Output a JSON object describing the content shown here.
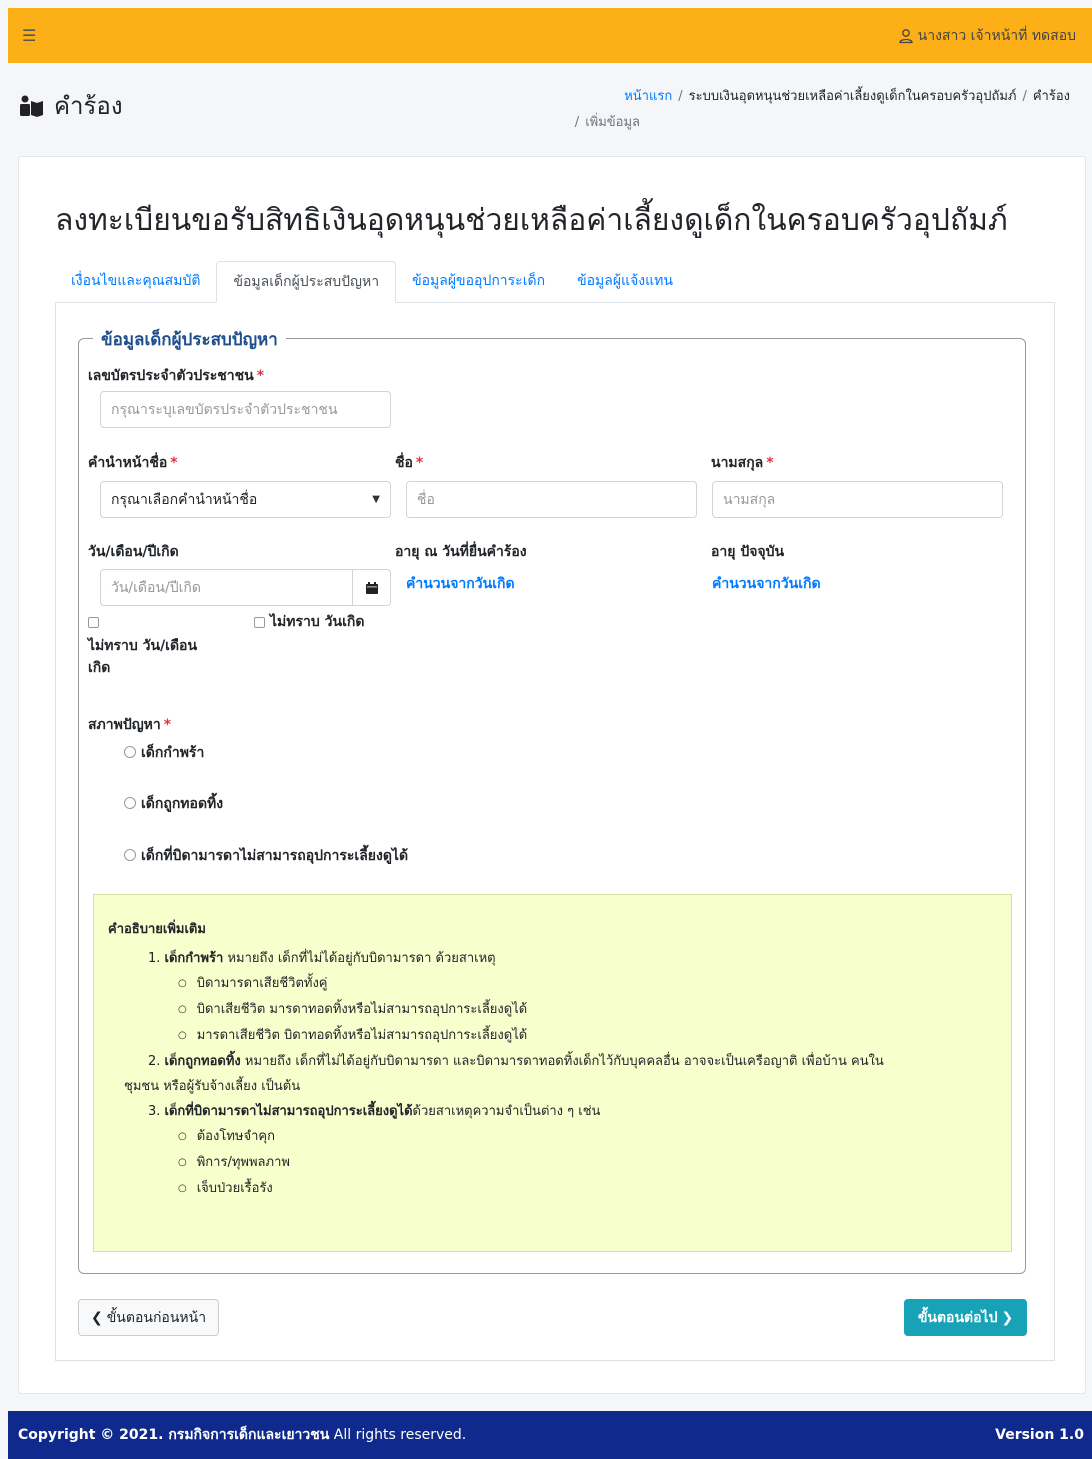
{
  "topbar": {
    "menu_icon": "hamburger-icon",
    "user_icon": "user-icon",
    "user_name": "นางสาว เจ้าหน้าที่ ทดสอบ"
  },
  "header": {
    "page_icon": "user-info-icon",
    "page_title": "คำร้อง",
    "breadcrumb": [
      "หน้าแรก",
      "ระบบเงินอุดหนุนช่วยเหลือค่าเลี้ยงดูเด็กในครอบครัวอุปถัมภ์",
      "คำร้อง",
      "เพิ่มข้อมูล"
    ]
  },
  "form": {
    "title": "ลงทะเบียนขอรับสิทธิเงินอุดหนุนช่วยเหลือค่าเลี้ยงดูเด็กในครอบครัวอุปถัมภ์",
    "tabs": [
      {
        "label": "เงื่อนไขและคุณสมบัติ",
        "active": false
      },
      {
        "label": "ข้อมูลเด็กผู้ประสบปัญหา",
        "active": true
      },
      {
        "label": "ข้อมูลผู้ขออุปการะเด็ก",
        "active": false
      },
      {
        "label": "ข้อมูลผู้แจ้งแทน",
        "active": false
      }
    ],
    "section_title": "ข้อมูลเด็กผู้ประสบปัญหา",
    "id_card": {
      "label": "เลขบัตรประจำตัวประชาชน",
      "placeholder": "กรุณาระบุเลขบัตรประจำตัวประชาชน",
      "value": ""
    },
    "prefix": {
      "label": "คำนำหน้าชื่อ",
      "selected": "กรุณาเลือกคำนำหน้าชื่อ"
    },
    "first_name": {
      "label": "ชื่อ",
      "placeholder": "ชื่อ",
      "value": ""
    },
    "last_name": {
      "label": "นามสกุล",
      "placeholder": "นามสกุล",
      "value": ""
    },
    "birth_date": {
      "label": "วัน/เดือน/ปีเกิด",
      "placeholder": "วัน/เดือน/ปีเกิด",
      "value": "",
      "icon": "calendar-icon"
    },
    "age_at_request": {
      "label": "อายุ ณ วันที่ยื่นคำร้อง",
      "value": "คำนวนจากวันเกิด"
    },
    "age_current": {
      "label": "อายุ ปัจจุบัน",
      "value": "คำนวนจากวันเกิด"
    },
    "unknown_day_month": {
      "line1": "ไม่ทราบ วัน/เดือน",
      "line2": "เกิด",
      "checked": false
    },
    "unknown_birth_date": {
      "label": "ไม่ทราบ วันเกิด",
      "checked": false
    },
    "problem_status": {
      "label": "สภาพปัญหา",
      "options": [
        "เด็กกำพร้า",
        "เด็กถูกทอดทิ้ง",
        "เด็กที่บิดามารดาไม่สามารถอุปการะเลี้ยงดูได้"
      ]
    },
    "required_mark": "*"
  },
  "notes": {
    "title": "คำอธิบายเพิ่มเติม",
    "items": [
      {
        "num": "1.",
        "term": "เด็กกำพร้า",
        "text": " หมายถึง เด็กที่ไม่ได้อยู่กับบิดามารดา ด้วยสาเหตุ",
        "subs": [
          "บิดามารดาเสียชีวิตทั้งคู่",
          "บิดาเสียชีวิต มารดาทอดทิ้งหรือไม่สามารถอุปการะเลี้ยงดูได้",
          "มารดาเสียชีวิต บิดาทอดทิ้งหรือไม่สามารถอุปการะเลี้ยงดูได้"
        ]
      },
      {
        "num": "2.",
        "term": "เด็กถูกทอดทิ้ง",
        "text": " หมายถึง เด็กที่ไม่ได้อยู่กับบิดามารดา และบิดามารดาทอดทิ้งเด็กไว้กับบุคคลอื่น อาจจะเป็นเครือญาติ เพื่อบ้าน คนใน",
        "text2": "ชุมชน หรือผู้รับจ้างเลี้ยง เป็นต้น",
        "subs": []
      },
      {
        "num": "3.",
        "term": "เด็กที่บิดามารดาไม่สามารถอุปการะเลี้ยงดูได้",
        "text": "ด้วยสาเหตุความจำเป็นต่าง ๆ เช่น",
        "subs": [
          "ต้องโทษจำคุก",
          "พิการ/ทุพพลภาพ",
          "เจ็บป่วยเรื้อรัง"
        ]
      }
    ]
  },
  "buttons": {
    "prev": "ขั้นตอนก่อนหน้า",
    "next": "ขั้นตอนต่อไป",
    "prev_icon": "chevron-left-icon",
    "next_icon": "chevron-right-icon"
  },
  "footer": {
    "copyright_prefix": "Copyright © 2021. กรมกิจการเด็กและเยาวชน",
    "copyright_suffix": " All rights reserved.",
    "version": "Version 1.0"
  },
  "colors": {
    "topbar": "#fdaf17",
    "footer": "#0f2a8c",
    "link": "#007bff",
    "next_button": "#17a2b8",
    "note_bg": "#f7ffcc"
  }
}
